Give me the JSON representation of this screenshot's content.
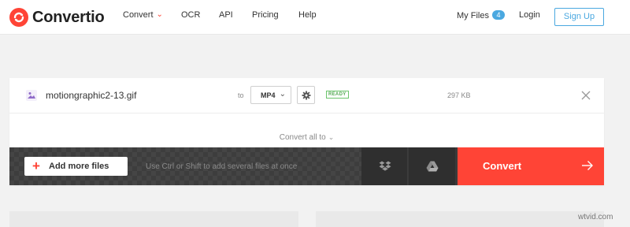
{
  "header": {
    "logo_text": "Convertio",
    "nav": {
      "convert": "Convert",
      "ocr": "OCR",
      "api": "API",
      "pricing": "Pricing",
      "help": "Help"
    },
    "my_files": "My Files",
    "my_files_count": "4",
    "login": "Login",
    "signup": "Sign Up"
  },
  "file": {
    "name": "motiongraphic2-13.gif",
    "to_label": "to",
    "format": "MP4",
    "status": "READY",
    "size": "297 KB"
  },
  "convert_all_label": "Convert all to",
  "action_bar": {
    "add_files_label": "Add more files",
    "hint": "Use Ctrl or Shift to add several files at once",
    "convert_label": "Convert"
  },
  "watermark": "wtvid.com",
  "colors": {
    "brand": "#ff4436",
    "accent": "#4aa8e0",
    "ready": "#52a852",
    "bar": "#3a3a3a"
  },
  "icons": {
    "logo": "convertio-logo-icon",
    "file": "image-file-icon",
    "settings": "gear-icon",
    "remove": "close-icon",
    "dropbox": "dropbox-icon",
    "drive": "google-drive-icon",
    "convert_arrow": "arrow-right-icon",
    "add": "plus-icon"
  }
}
